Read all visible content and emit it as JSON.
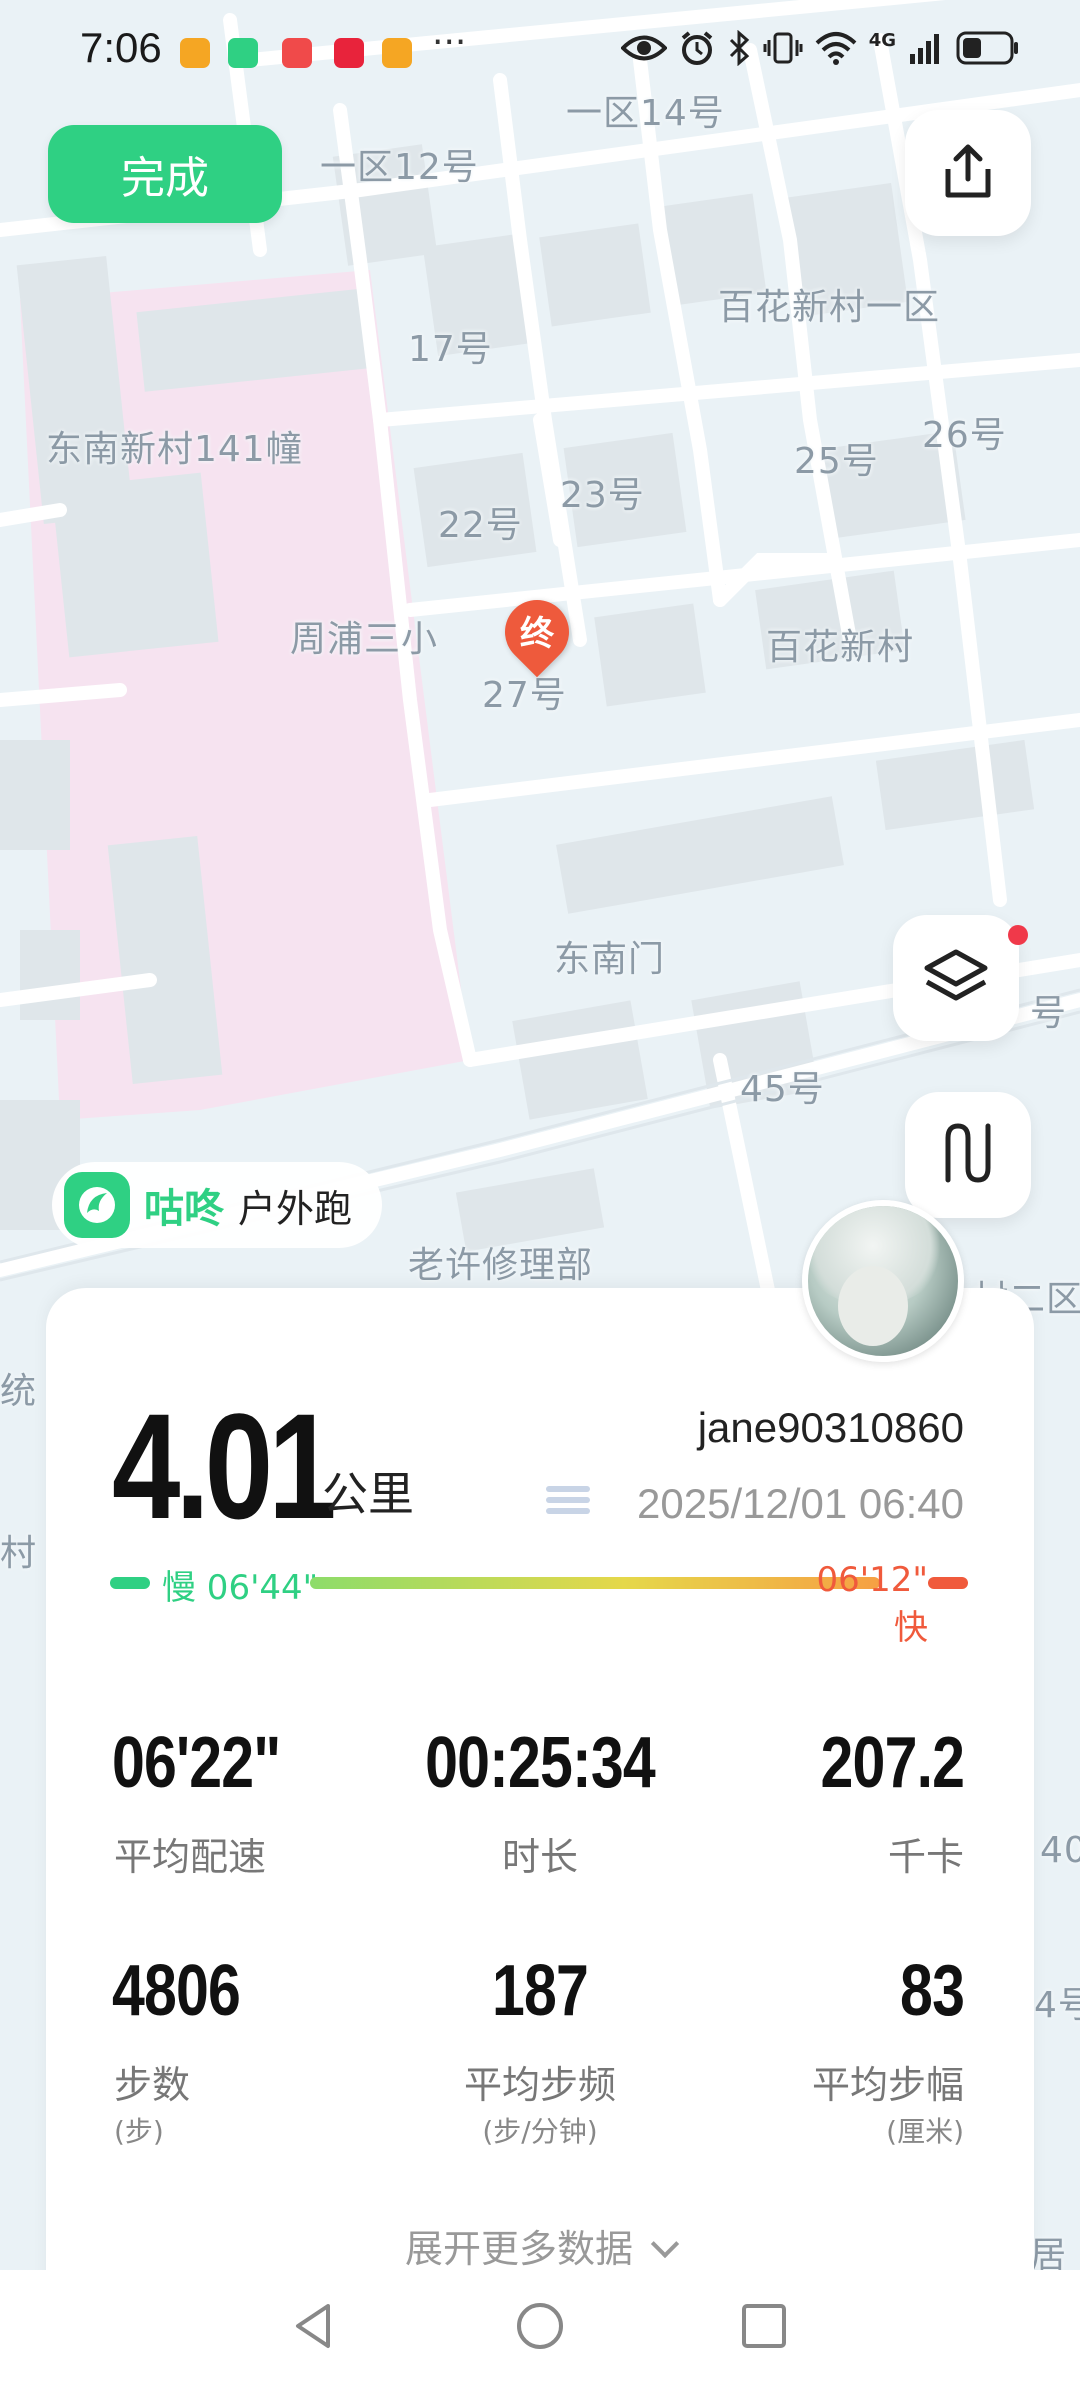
{
  "status_bar": {
    "time": "7:06",
    "more": "···",
    "network": "4G",
    "icons": [
      "eye-icon",
      "alarm-icon",
      "bluetooth-icon",
      "vibrate-icon",
      "wifi-icon",
      "signal-icon",
      "battery-icon"
    ]
  },
  "header": {
    "done_label": "完成",
    "share_icon": "share-icon"
  },
  "map": {
    "labels": [
      "一区14号",
      "一区12号",
      "百花新村一区",
      "17号",
      "东南新村141幢",
      "26号",
      "25号",
      "22号",
      "23号",
      "周浦三小",
      "百花新村",
      "27号",
      "东南门",
      "45号",
      "老许修理部",
      "村二区",
      "号",
      "统",
      "村",
      "40",
      "4号",
      "居"
    ],
    "end_marker": "终",
    "layers_icon": "layers-icon",
    "route_icon": "route-icon"
  },
  "brand": {
    "name": "咕咚",
    "mode": "户外跑"
  },
  "summary": {
    "distance": "4.01",
    "distance_unit": "公里",
    "username": "jane90310860",
    "datetime": "2025/12/01 06:40",
    "pace_slow_label": "慢 06'44\"",
    "pace_fast_label": "06'12\" 快"
  },
  "stats": [
    {
      "value": "06'22\"",
      "label": "平均配速",
      "sub": ""
    },
    {
      "value": "00:25:34",
      "label": "时长",
      "sub": ""
    },
    {
      "value": "207.2",
      "label": "千卡",
      "sub": ""
    },
    {
      "value": "4806",
      "label": "步数",
      "sub": "(步)"
    },
    {
      "value": "187",
      "label": "平均步频",
      "sub": "(步/分钟)"
    },
    {
      "value": "83",
      "label": "平均步幅",
      "sub": "(厘米)"
    }
  ],
  "expand_label": "展开更多数据",
  "colors": {
    "accent": "#2fd083",
    "slow": "#2fd083",
    "fast": "#f05a3c",
    "marker": "#ee5a3c"
  }
}
